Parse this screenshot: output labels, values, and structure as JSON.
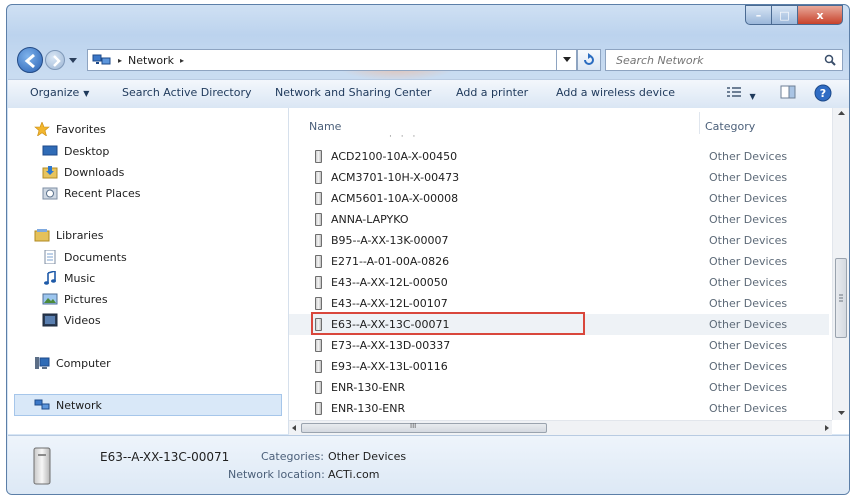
{
  "window": {
    "title_buttons": {
      "minimize": "–",
      "maximize": "□",
      "close": "x"
    }
  },
  "address_bar": {
    "icon": "network-icon",
    "breadcrumb": [
      "Network"
    ],
    "separator": "▸"
  },
  "search": {
    "placeholder": "Search Network",
    "icon": "search-icon"
  },
  "toolbar": {
    "organize": "Organize",
    "search_ad": "Search Active Directory",
    "network_center": "Network and Sharing Center",
    "add_printer": "Add a printer",
    "add_wireless": "Add a wireless device"
  },
  "sidebar": {
    "favorites": {
      "label": "Favorites",
      "items": [
        "Desktop",
        "Downloads",
        "Recent Places"
      ]
    },
    "libraries": {
      "label": "Libraries",
      "items": [
        "Documents",
        "Music",
        "Pictures",
        "Videos"
      ]
    },
    "computer": "Computer",
    "network": "Network"
  },
  "file_list": {
    "columns": {
      "name": "Name",
      "category": "Category"
    },
    "rows": [
      {
        "name": "ACD2100-10A-X-00450",
        "category": "Other Devices"
      },
      {
        "name": "ACM3701-10H-X-00473",
        "category": "Other Devices"
      },
      {
        "name": "ACM5601-10A-X-00008",
        "category": "Other Devices"
      },
      {
        "name": "ANNA-LAPYKO",
        "category": "Other Devices"
      },
      {
        "name": "B95--A-XX-13K-00007",
        "category": "Other Devices"
      },
      {
        "name": "E271--A-01-00A-0826",
        "category": "Other Devices"
      },
      {
        "name": "E43--A-XX-12L-00050",
        "category": "Other Devices"
      },
      {
        "name": "E43--A-XX-12L-00107",
        "category": "Other Devices"
      },
      {
        "name": "E63--A-XX-13C-00071",
        "category": "Other Devices"
      },
      {
        "name": "E73--A-XX-13D-00337",
        "category": "Other Devices"
      },
      {
        "name": "E93--A-XX-13L-00116",
        "category": "Other Devices"
      },
      {
        "name": "ENR-130-ENR",
        "category": "Other Devices"
      },
      {
        "name": "ENR-130-ENR",
        "category": "Other Devices"
      }
    ],
    "selected_index": 8,
    "hscroll_grip": "III"
  },
  "details": {
    "name": "E63--A-XX-13C-00071",
    "categories_label": "Categories:",
    "categories_value": "Other Devices",
    "location_label": "Network location:",
    "location_value": "ACTi.com"
  },
  "colors": {
    "highlight_box": "#d9473c",
    "selection": "#d9e8f8"
  }
}
